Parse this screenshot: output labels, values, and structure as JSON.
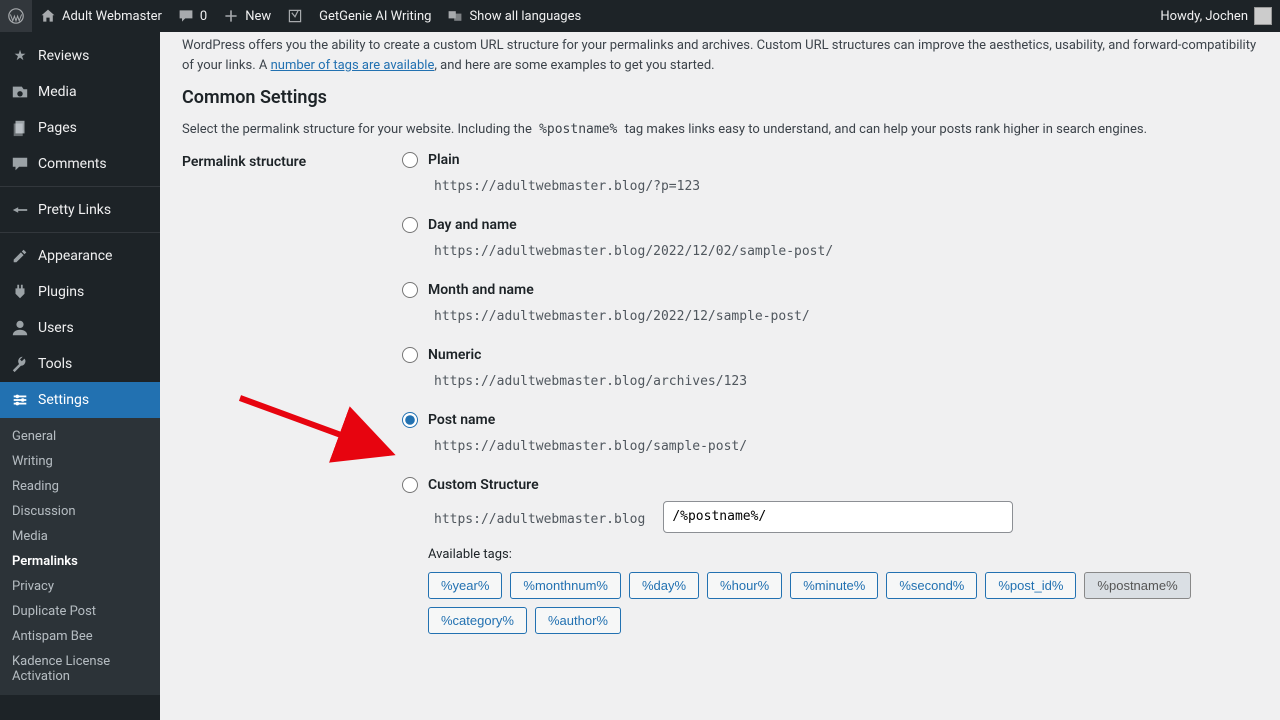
{
  "adminbar": {
    "site": "Adult Webmaster",
    "comments": "0",
    "new": "New",
    "genie": "GetGenie AI Writing",
    "langs": "Show all languages",
    "howdy": "Howdy, Jochen"
  },
  "menu": {
    "reviews": "Reviews",
    "media": "Media",
    "pages": "Pages",
    "comments": "Comments",
    "prettylinks": "Pretty Links",
    "appearance": "Appearance",
    "plugins": "Plugins",
    "users": "Users",
    "tools": "Tools",
    "settings": "Settings",
    "sub": {
      "general": "General",
      "writing": "Writing",
      "reading": "Reading",
      "discussion": "Discussion",
      "media": "Media",
      "permalinks": "Permalinks",
      "privacy": "Privacy",
      "duplicate": "Duplicate Post",
      "antispam": "Antispam Bee",
      "kadence": "Kadence License Activation"
    }
  },
  "page": {
    "intro1": "WordPress offers you the ability to create a custom URL structure for your permalinks and archives. Custom URL structures can improve the aesthetics, usability, and forward-compatibility of your links. A ",
    "intro_link": "number of tags are available",
    "intro2": ", and here are some examples to get you started.",
    "h2": "Common Settings",
    "select_text1": "Select the permalink structure for your website. Including the ",
    "postname_tag": "%postname%",
    "select_text2": " tag makes links easy to understand, and can help your posts rank higher in search engines.",
    "th": "Permalink structure",
    "opts": {
      "plain": {
        "label": "Plain",
        "url": "https://adultwebmaster.blog/?p=123"
      },
      "dayname": {
        "label": "Day and name",
        "url": "https://adultwebmaster.blog/2022/12/02/sample-post/"
      },
      "monthname": {
        "label": "Month and name",
        "url": "https://adultwebmaster.blog/2022/12/sample-post/"
      },
      "numeric": {
        "label": "Numeric",
        "url": "https://adultwebmaster.blog/archives/123"
      },
      "postname": {
        "label": "Post name",
        "url": "https://adultwebmaster.blog/sample-post/"
      },
      "custom": {
        "label": "Custom Structure",
        "base": "https://adultwebmaster.blog",
        "value": "/%postname%/"
      }
    },
    "available_tags": "Available tags:",
    "tags": [
      "%year%",
      "%monthnum%",
      "%day%",
      "%hour%",
      "%minute%",
      "%second%",
      "%post_id%",
      "%postname%",
      "%category%",
      "%author%"
    ],
    "active_tag_index": 7
  }
}
